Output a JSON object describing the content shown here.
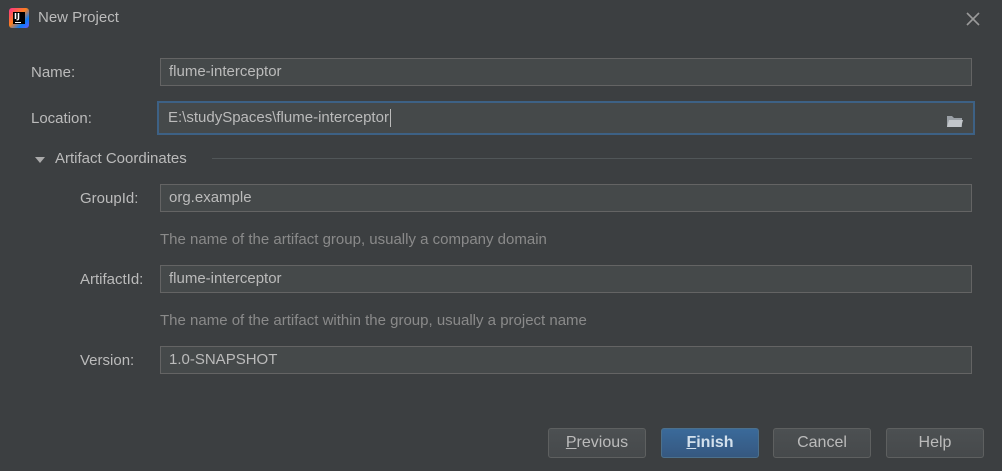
{
  "window": {
    "title": "New Project",
    "icon": "intellij-idea-icon"
  },
  "form": {
    "name": {
      "label": "Name:",
      "value": "flume-interceptor"
    },
    "location": {
      "label": "Location:",
      "value": "E:\\studySpaces\\flume-interceptor"
    },
    "section": {
      "label": "Artifact Coordinates",
      "expanded": true
    },
    "group_id": {
      "label": "GroupId:",
      "value": "org.example",
      "hint": "The name of the artifact group, usually a company domain"
    },
    "artifact_id": {
      "label": "ArtifactId:",
      "value": "flume-interceptor",
      "hint": "The name of the artifact within the group, usually a project name"
    },
    "version": {
      "label": "Version:",
      "value": "1.0-SNAPSHOT"
    }
  },
  "buttons": {
    "previous": {
      "mnemonic": "P",
      "rest": "revious"
    },
    "finish": {
      "mnemonic": "F",
      "rest": "inish"
    },
    "cancel": {
      "label": "Cancel"
    },
    "help": {
      "label": "Help"
    }
  },
  "colors": {
    "background": "#3c3f41",
    "field_background": "#45494a",
    "focus_border": "#3d6185",
    "primary_button": "#365880",
    "text": "#bbbbbb",
    "hint_text": "#8a8a8a"
  }
}
